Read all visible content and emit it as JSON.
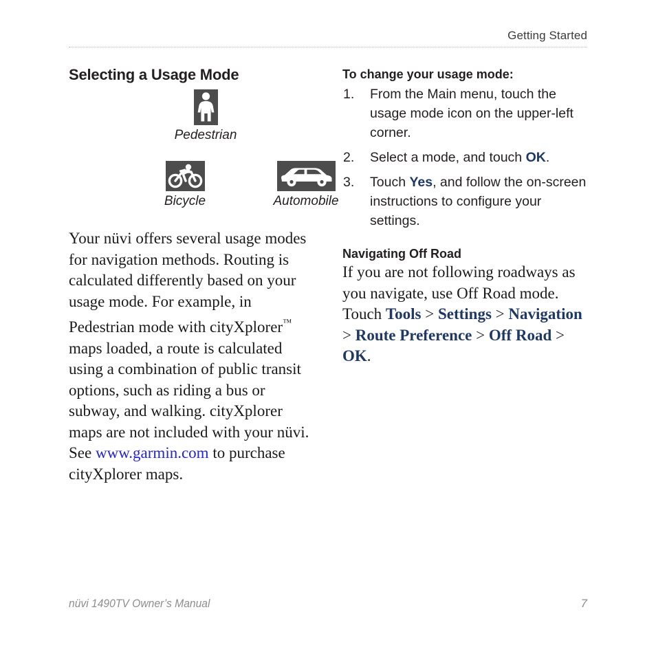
{
  "header": {
    "title": "Getting Started"
  },
  "left_column": {
    "heading": "Selecting a Usage Mode",
    "figures": [
      {
        "icon": "pedestrian-icon",
        "caption": "Pedestrian"
      },
      {
        "icon": "bicycle-icon",
        "caption": "Bicycle"
      },
      {
        "icon": "automobile-icon",
        "caption": "Automobile"
      }
    ],
    "paragraph": {
      "part1": "Your nüvi offers several usage modes for navigation methods. Routing is calculated differently based on your usage mode. For example, in Pedestrian mode with cityXplorer",
      "trademark": "™",
      "part2": " maps loaded, a route is calculated using a combination of public transit options, such as riding a bus or subway, and walking. cityXplorer maps are not included with your nüvi. See ",
      "link_text": "www.garmin.com",
      "part3": " to purchase cityXplorer maps."
    }
  },
  "right_column": {
    "procedure_heading": "To change your usage mode:",
    "steps": [
      {
        "number": "1.",
        "text_before": "From the Main menu, touch the usage mode icon on the upper-left corner.",
        "term": "",
        "text_after": ""
      },
      {
        "number": "2.",
        "text_before": "Select a mode, and touch ",
        "term": "OK",
        "text_after": "."
      },
      {
        "number": "3.",
        "text_before": "Touch ",
        "term": "Yes",
        "text_after": ", and follow the on-screen instructions to configure your settings."
      }
    ],
    "offroad_heading": "Navigating Off Road",
    "offroad": {
      "intro": "If you are not following roadways as you navigate, use Off Road mode. Touch ",
      "path": [
        "Tools",
        "Settings",
        "Navigation",
        "Route Preference",
        "Off Road",
        "OK"
      ],
      "separator": " > ",
      "end": "."
    }
  },
  "footer": {
    "manual_title": "nüvi 1490TV Owner’s Manual",
    "page_number": "7"
  },
  "colors": {
    "ui_term_blue": "#1f3864",
    "link_blue": "#2323d8",
    "icon_tile": "#4c4c4c",
    "footer_gray": "#8d8d8d",
    "text": "#231f20"
  }
}
